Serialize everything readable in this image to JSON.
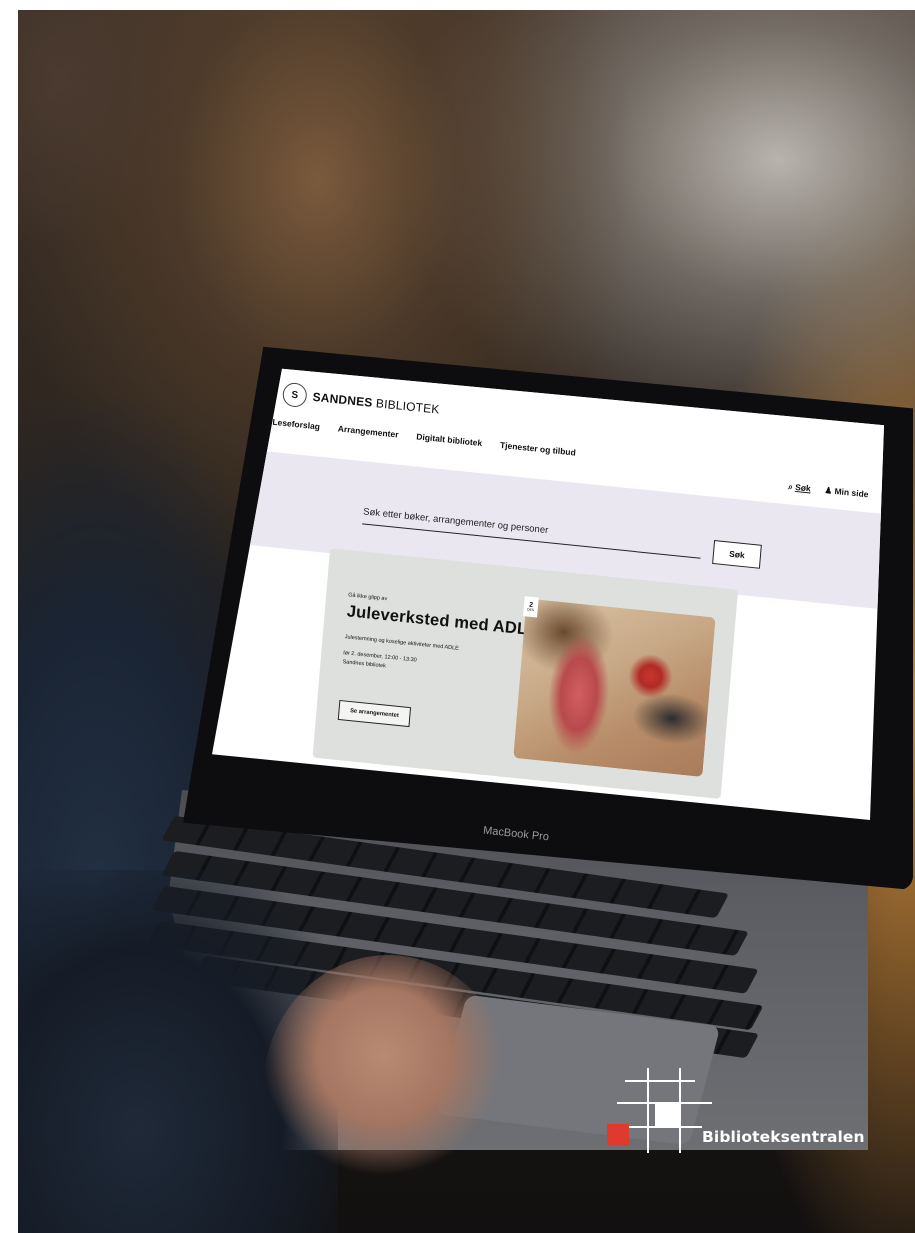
{
  "site": {
    "logo_name_bold": "SANDNES",
    "logo_name_rest": " BIBLIOTEK",
    "logo_mark": "S"
  },
  "nav": {
    "items": [
      {
        "label": "Leseforslag"
      },
      {
        "label": "Arrangementer"
      },
      {
        "label": "Digitalt bibliotek"
      },
      {
        "label": "Tjenester og tilbud"
      }
    ]
  },
  "utility": {
    "search_label": "Søk",
    "account_label": "Min side"
  },
  "search": {
    "placeholder": "Søk etter bøker, arrangementer og personer",
    "button_label": "Søk"
  },
  "feature": {
    "eyebrow": "Gå ikke glipp av",
    "title": "Juleverksted med ADLE",
    "description": "Julestemning og koselige aktiviteter med ADLE",
    "date": "lør 2. desember, 12:00 - 13:30",
    "location": "Sandnes bibliotek",
    "cta_label": "Se arrangementet",
    "badge_day": "2",
    "badge_month": "DES"
  },
  "device": {
    "brand_text": "MacBook Pro"
  },
  "footer_brand": {
    "name": "Biblioteksentralen",
    "accent_color": "#e03a2f"
  }
}
